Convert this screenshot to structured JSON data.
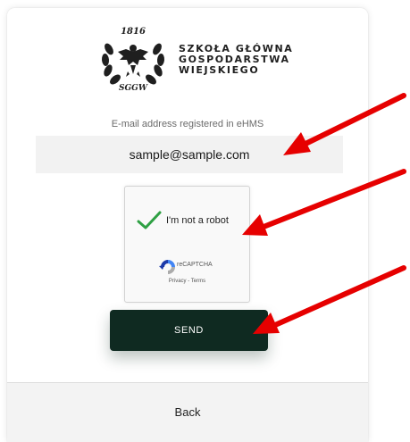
{
  "logo": {
    "year": "1816",
    "monogram": "SGGW",
    "lines": [
      "SZKOŁA GŁÓWNA",
      "GOSPODARSTWA",
      "WIEJSKIEGO"
    ]
  },
  "form": {
    "email_label": "E-mail address registered in eHMS",
    "email_value": "sample@sample.com"
  },
  "recaptcha": {
    "checked": true,
    "label": "I'm not a robot",
    "brand": "reCAPTCHA",
    "links": "Privacy - Terms"
  },
  "send_label": "SEND",
  "footer": {
    "back_label": "Back"
  },
  "colors": {
    "send_button": "#0f2a21",
    "check_green": "#2ea043",
    "annotation_arrow": "#e60000"
  }
}
